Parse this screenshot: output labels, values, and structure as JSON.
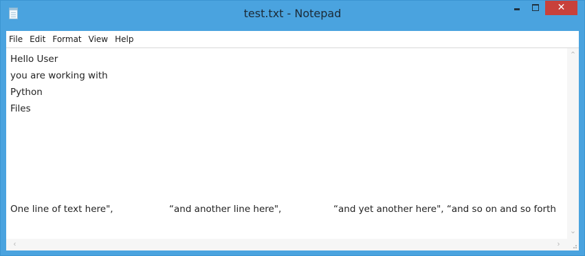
{
  "window": {
    "title": "test.txt - Notepad",
    "close_label": "✕"
  },
  "menu": [
    "File",
    "Edit",
    "Format",
    "View",
    "Help"
  ],
  "lines": [
    "Hello User",
    "you are working with",
    "Python",
    "Files"
  ],
  "bottom_line": {
    "part1": "One line of text here\",",
    "part2": "“and another line here\",",
    "part3": "“and yet another here\", “and so on and so forth"
  },
  "scroll": {
    "up": "⌃",
    "down": "⌄",
    "left": "‹",
    "right": "›"
  }
}
